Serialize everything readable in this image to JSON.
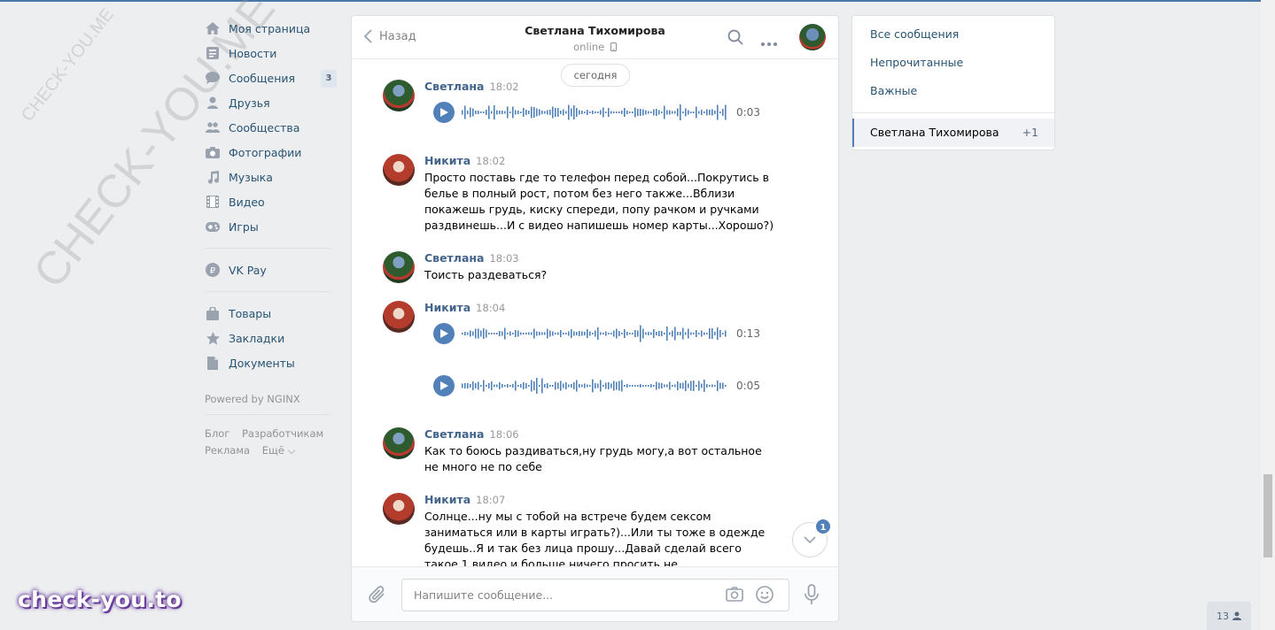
{
  "watermarks": {
    "diag_small": "CHECK-YOU.ME",
    "diag_large": "CHECK-YOU.ME",
    "brand": "check-you.to"
  },
  "nav": {
    "items": [
      {
        "label": "Моя страница",
        "icon": "home-icon"
      },
      {
        "label": "Новости",
        "icon": "news-icon"
      },
      {
        "label": "Сообщения",
        "icon": "messages-icon",
        "badge": "3"
      },
      {
        "label": "Друзья",
        "icon": "friends-icon"
      },
      {
        "label": "Сообщества",
        "icon": "communities-icon"
      },
      {
        "label": "Фотографии",
        "icon": "camera-icon"
      },
      {
        "label": "Музыка",
        "icon": "music-icon"
      },
      {
        "label": "Видео",
        "icon": "video-icon"
      },
      {
        "label": "Игры",
        "icon": "gamepad-icon"
      }
    ],
    "pay": {
      "label": "VK Pay",
      "icon": "ruble-icon"
    },
    "extra": [
      {
        "label": "Товары",
        "icon": "bag-icon"
      },
      {
        "label": "Закладки",
        "icon": "star-icon"
      },
      {
        "label": "Документы",
        "icon": "document-icon"
      }
    ],
    "powered": "Powered by NGINX",
    "footer": {
      "blog": "Блог",
      "devs": "Разработчикам",
      "ads": "Реклама",
      "more": "Ещё ⌵"
    }
  },
  "chat": {
    "back_label": "Назад",
    "peer_name": "Светлана Тихомирова",
    "peer_status": "online",
    "date_divider": "сегодня",
    "messages": [
      {
        "author": "Светлана",
        "time": "18:02",
        "voice": [
          {
            "duration": "0:03"
          }
        ]
      },
      {
        "author": "Никита",
        "time": "18:02",
        "text": "Просто поставь где то телефон перед собой...Покрутись в белье в полный рост, потом без него также...Вблизи покажешь грудь, киску спереди, попу рачком и ручками раздвинешь...И с видео напишешь номер карты...Хорошо?)"
      },
      {
        "author": "Светлана",
        "time": "18:03",
        "text": "Тоисть раздеваться?"
      },
      {
        "author": "Никита",
        "time": "18:04",
        "voice": [
          {
            "duration": "0:13"
          },
          {
            "duration": "0:05"
          }
        ]
      },
      {
        "author": "Светлана",
        "time": "18:06",
        "text": "Как то боюсь раздиваться,ну грудь могу,а вот остальное не много не по себе"
      },
      {
        "author": "Никита",
        "time": "18:07",
        "text": "Солнце...ну мы с тобой на встрече будем сексом заниматься или в карты играть?)...Или ты тоже в одежде будешь..Я и так без лица прошу...Давай сделай всего такое 1 видео и больше ничего просить не буду...Договорились?)"
      }
    ],
    "unread_badge": "1",
    "composer_placeholder": "Напишите сообщение..."
  },
  "filters": {
    "all": "Все сообщения",
    "unread": "Непрочитанные",
    "important": "Важные",
    "active_chat": "Светлана Тихомирова",
    "active_count": "+1"
  },
  "online_count": "13",
  "colors": {
    "accent": "#5181b8",
    "link": "#285473",
    "author": "#42648b",
    "bg": "#edeef0"
  }
}
